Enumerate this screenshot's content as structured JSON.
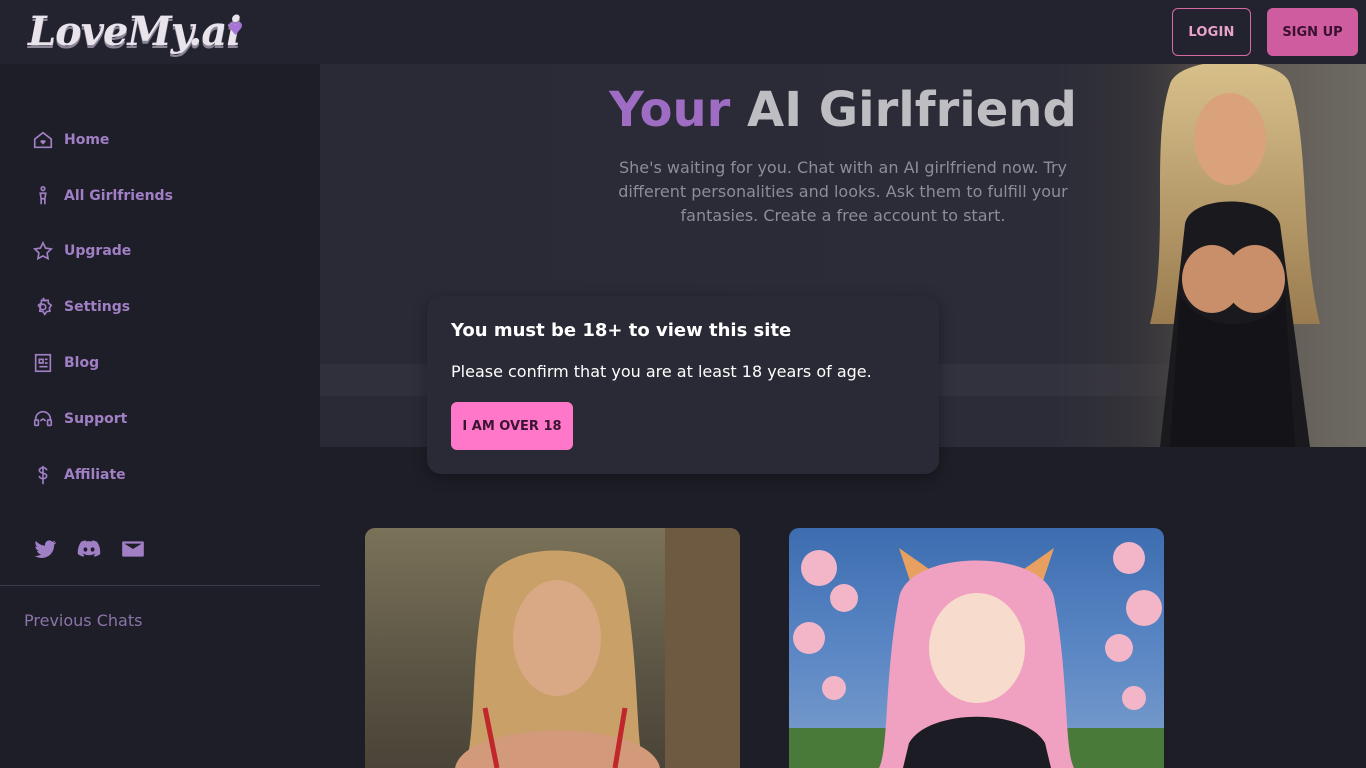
{
  "header": {
    "logo_text": "LoveMy.ai",
    "login_label": "LOGIN",
    "signup_label": "SIGN UP"
  },
  "sidebar": {
    "items": [
      {
        "label": "Home",
        "icon": "home-heart-icon"
      },
      {
        "label": "All Girlfriends",
        "icon": "person-icon"
      },
      {
        "label": "Upgrade",
        "icon": "star-icon"
      },
      {
        "label": "Settings",
        "icon": "gear-icon"
      },
      {
        "label": "Blog",
        "icon": "document-icon"
      },
      {
        "label": "Support",
        "icon": "headset-icon"
      },
      {
        "label": "Affiliate",
        "icon": "dollar-icon"
      }
    ],
    "social": [
      "twitter-icon",
      "discord-icon",
      "mail-icon"
    ],
    "previous_chats_label": "Previous Chats"
  },
  "hero": {
    "title_accent": "Your",
    "title_rest": "AI Girlfriend",
    "subtitle": "She's waiting for you. Chat with an AI girlfriend now. Try different personalities and looks. Ask them to fulfill your fantasies. Create a free account to start."
  },
  "modal": {
    "title": "You must be 18+ to view this site",
    "text": "Please confirm that you are at least 18 years of age.",
    "button_label": "I AM OVER 18"
  },
  "colors": {
    "accent_purple": "#a07fc4",
    "accent_pink": "#ff77c8",
    "background": "#1e1e28"
  }
}
